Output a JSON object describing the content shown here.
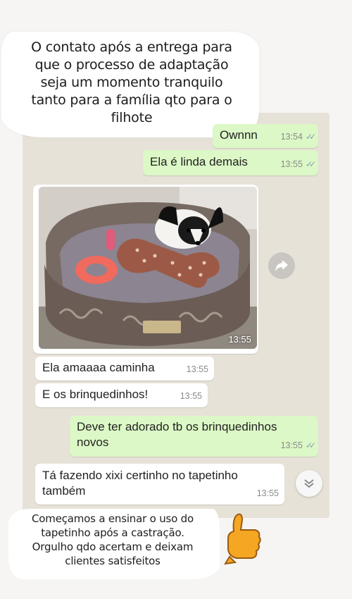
{
  "banner_top": {
    "text": "O contato após a entrega para\nque o processo de adaptação\nseja um momento tranquilo\ntanto para a família qto para o\nfilhote"
  },
  "messages": [
    {
      "text": "Ownnn",
      "time": "13:54",
      "direction": "out",
      "ticks": "✓✓"
    },
    {
      "text": "Ela é linda demais",
      "time": "13:55",
      "direction": "out",
      "ticks": "✓✓"
    },
    {
      "photo_time": "13:55",
      "direction": "in"
    },
    {
      "text": "Ela amaaaa caminha",
      "time": "13:55",
      "direction": "in"
    },
    {
      "text": "E os brinquedinhos!",
      "time": "13:55",
      "direction": "in"
    },
    {
      "text": "Deve ter adorado tb os brinquedinhos\nnovos",
      "time": "13:55",
      "direction": "out",
      "ticks": "✓✓"
    },
    {
      "text": "Tá fazendo xixi certinho no tapetinho\ntambém",
      "time": "13:55",
      "direction": "in"
    }
  ],
  "banner_bottom": {
    "text": "Começamos a ensinar o uso do\ntapetinho após a castração.\nOrgulho qdo acertam e deixam\nclientes satisfeitos"
  },
  "icons": {
    "forward": "forward-arrow-icon",
    "scroll_down": "double-chevron-down-icon",
    "emoji": "thumbs-up-emoji-icon"
  },
  "colors": {
    "outgoing_bubble": "#dcf8c6",
    "incoming_bubble": "#ffffff",
    "chat_background": "#e7e2d8",
    "read_ticks": "#8aa0b0"
  }
}
